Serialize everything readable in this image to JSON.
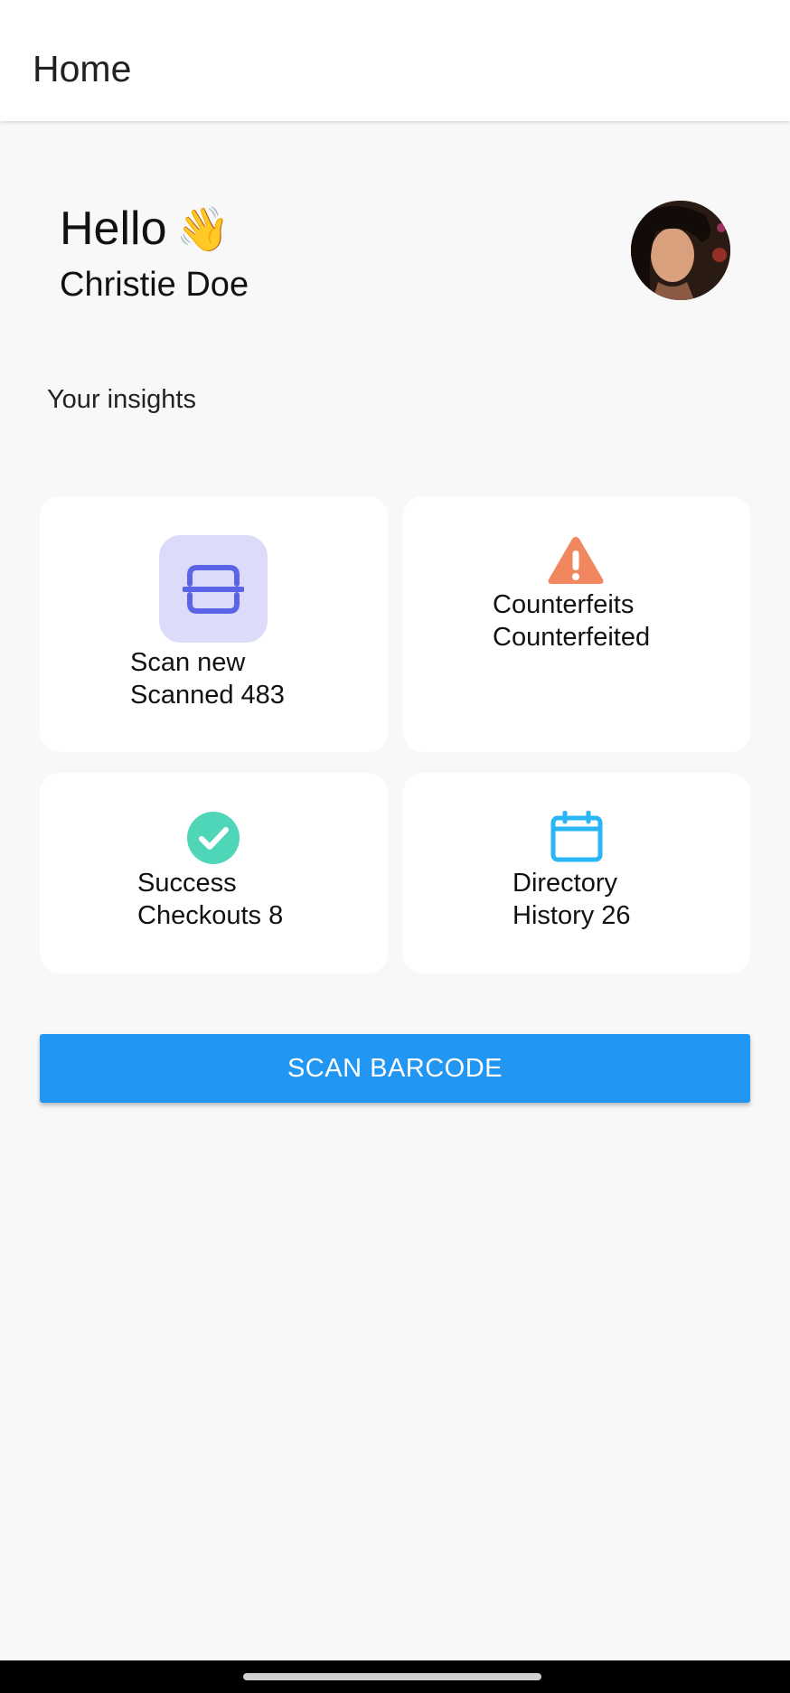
{
  "appbar": {
    "title": "Home"
  },
  "header": {
    "greeting": "Hello",
    "wave_emoji": "👋",
    "username": "Christie Doe",
    "avatar_icon": "user-avatar-photo"
  },
  "insights": {
    "section_title": "Your insights",
    "cards": [
      {
        "title": "Scan new",
        "subtitle": "Scanned 483",
        "icon": "scan-frame-icon",
        "color": "#5b63e6",
        "icon_bg": "#dcdcfa"
      },
      {
        "title": "Counterfeits",
        "subtitle": "Counterfeited",
        "icon": "warning-triangle-icon",
        "color": "#f0875f"
      },
      {
        "title": "Success",
        "subtitle": "Checkouts 8",
        "icon": "check-circle-icon",
        "color": "#4fd6b8"
      },
      {
        "title": "Directory",
        "subtitle": "History 26",
        "icon": "calendar-icon",
        "color": "#29b6f6"
      }
    ]
  },
  "actions": {
    "scan_barcode_label": "SCAN BARCODE",
    "button_color": "#2196f3"
  }
}
